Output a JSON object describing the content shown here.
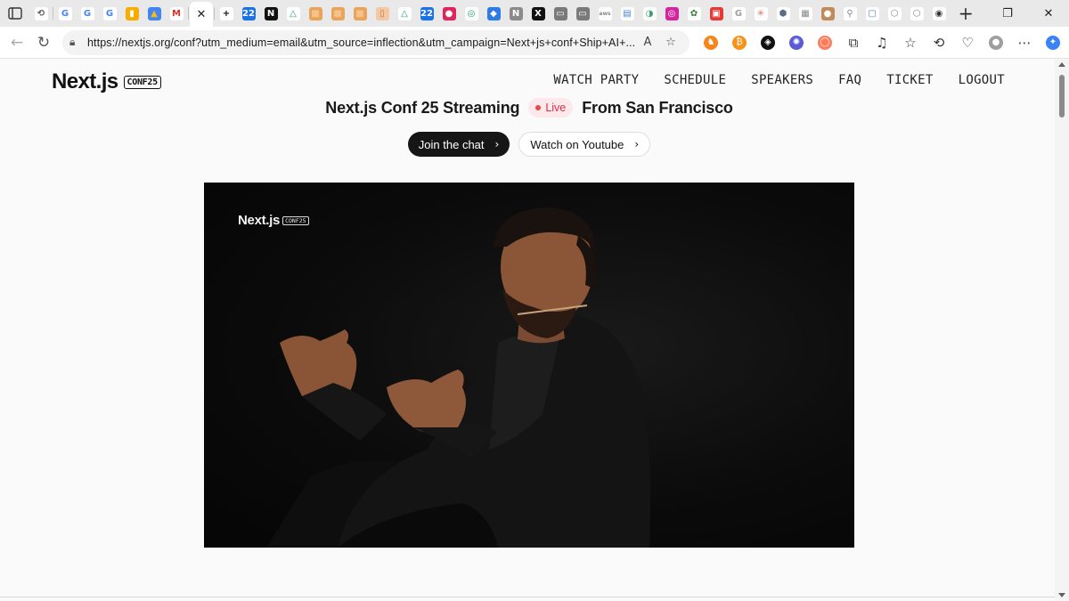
{
  "browser": {
    "tabs": [
      {
        "icon": "history-icon",
        "color": "#ffffff",
        "glyph": "⟲",
        "fg": "#555"
      },
      {
        "icon": "google-icon",
        "color": "#ffffff",
        "glyph": "G",
        "fg": "#4285f4"
      },
      {
        "icon": "google-icon",
        "color": "#ffffff",
        "glyph": "G",
        "fg": "#4285f4"
      },
      {
        "icon": "google-icon",
        "color": "#ffffff",
        "glyph": "G",
        "fg": "#4285f4"
      },
      {
        "icon": "analytics-icon",
        "color": "#f9ab00",
        "glyph": "▮",
        "fg": "#fff"
      },
      {
        "icon": "ads-icon",
        "color": "#4285f4",
        "glyph": "▲",
        "fg": "#fbbc04"
      },
      {
        "icon": "gmail-icon",
        "color": "#ffffff",
        "glyph": "M",
        "fg": "#d93025"
      },
      {
        "icon": "close-icon",
        "color": "#ffffff",
        "glyph": "✕",
        "fg": "#222",
        "active": true
      },
      {
        "icon": "notion-icon",
        "color": "#ffffff",
        "glyph": "+",
        "fg": "#111"
      },
      {
        "icon": "calendar-icon",
        "color": "#1a73e8",
        "glyph": "22",
        "fg": "#fff"
      },
      {
        "icon": "nextjs-icon",
        "color": "#111111",
        "glyph": "N",
        "fg": "#fff"
      },
      {
        "icon": "drive-icon",
        "color": "#ffffff",
        "glyph": "△",
        "fg": "#1fa463"
      },
      {
        "icon": "box-icon",
        "color": "#e8a45a",
        "glyph": "■",
        "fg": "#f6c28b"
      },
      {
        "icon": "box-icon",
        "color": "#e8a45a",
        "glyph": "■",
        "fg": "#f6c28b"
      },
      {
        "icon": "box-icon",
        "color": "#e8a45a",
        "glyph": "■",
        "fg": "#f6c28b"
      },
      {
        "icon": "bottle-icon",
        "color": "#f3c9a5",
        "glyph": "▯",
        "fg": "#c47a3a"
      },
      {
        "icon": "drive-icon",
        "color": "#ffffff",
        "glyph": "△",
        "fg": "#1fa463"
      },
      {
        "icon": "calendar-icon",
        "color": "#1a73e8",
        "glyph": "22",
        "fg": "#fff"
      },
      {
        "icon": "chat-icon",
        "color": "#e0245e",
        "glyph": "●",
        "fg": "#fff"
      },
      {
        "icon": "circle-icon",
        "color": "#ffffff",
        "glyph": "◎",
        "fg": "#20a35a"
      },
      {
        "icon": "cube-icon",
        "color": "#2d7be5",
        "glyph": "◆",
        "fg": "#fff"
      },
      {
        "icon": "n-icon",
        "color": "#8a8a8a",
        "glyph": "N",
        "fg": "#fff"
      },
      {
        "icon": "x-icon",
        "color": "#111111",
        "glyph": "X",
        "fg": "#fff"
      },
      {
        "icon": "window-icon",
        "color": "#7a7a7a",
        "glyph": "▭",
        "fg": "#fff"
      },
      {
        "icon": "window-icon",
        "color": "#7a7a7a",
        "glyph": "▭",
        "fg": "#fff"
      },
      {
        "icon": "aws-icon",
        "color": "#ffffff",
        "glyph": "aws",
        "fg": "#888"
      },
      {
        "icon": "doc-icon",
        "color": "#ffffff",
        "glyph": "▤",
        "fg": "#4a7fd4"
      },
      {
        "icon": "circle-icon",
        "color": "#ffffff",
        "glyph": "◑",
        "fg": "#2fa36b"
      },
      {
        "icon": "instagram-icon",
        "color": "#d6249f",
        "glyph": "◎",
        "fg": "#fff"
      },
      {
        "icon": "people-icon",
        "color": "#ffffff",
        "glyph": "✿",
        "fg": "#2e7d32"
      },
      {
        "icon": "badge-icon",
        "color": "#e53935",
        "glyph": "▣",
        "fg": "#fff"
      },
      {
        "icon": "google-icon",
        "color": "#ffffff",
        "glyph": "G",
        "fg": "#9aa0a6"
      },
      {
        "icon": "asterisk-icon",
        "color": "#ffffff",
        "glyph": "✳",
        "fg": "#d97757"
      },
      {
        "icon": "hex-icon",
        "color": "#ffffff",
        "glyph": "⬢",
        "fg": "#5b6b8a"
      },
      {
        "icon": "grid-icon",
        "color": "#ffffff",
        "glyph": "▦",
        "fg": "#888"
      },
      {
        "icon": "face-icon",
        "color": "#c08a5a",
        "glyph": "●",
        "fg": "#fff"
      },
      {
        "icon": "search-icon",
        "color": "#ffffff",
        "glyph": "⚲",
        "fg": "#7a8aa0"
      },
      {
        "icon": "screen-icon",
        "color": "#ffffff",
        "glyph": "▢",
        "fg": "#5b7fbf"
      },
      {
        "icon": "hex-icon",
        "color": "#ffffff",
        "glyph": "⬡",
        "fg": "#888"
      },
      {
        "icon": "hex-icon",
        "color": "#ffffff",
        "glyph": "⬡",
        "fg": "#888"
      },
      {
        "icon": "github-icon",
        "color": "#ffffff",
        "glyph": "◉",
        "fg": "#333"
      }
    ],
    "url": "https://nextjs.org/conf?utm_medium=email&utm_source=inflection&utm_campaign=Next+js+conf+Ship+AI+...",
    "extensions": [
      {
        "icon": "metamask-icon",
        "color": "#f6851b",
        "glyph": "♞"
      },
      {
        "icon": "coin-icon",
        "color": "#f7931a",
        "glyph": "₿"
      },
      {
        "icon": "wallet-icon",
        "color": "#111111",
        "glyph": "◈"
      },
      {
        "icon": "gear-icon",
        "color": "#5b5bd6",
        "glyph": "✺"
      },
      {
        "icon": "ring-icon",
        "color": "#ff7b5a",
        "glyph": "◯"
      },
      {
        "icon": "puzzle-icon",
        "color": "",
        "glyph": "⧉"
      },
      {
        "icon": "music-icon",
        "color": "",
        "glyph": "♫"
      },
      {
        "icon": "favorites-icon",
        "color": "",
        "glyph": "☆"
      },
      {
        "icon": "history-icon",
        "color": "",
        "glyph": "⟲"
      },
      {
        "icon": "health-icon",
        "color": "",
        "glyph": "♡"
      },
      {
        "icon": "profile-icon",
        "color": "#9e9e9e",
        "glyph": "●"
      },
      {
        "icon": "more-icon",
        "color": "",
        "glyph": "⋯"
      },
      {
        "icon": "copilot-icon",
        "color": "#3b82f6",
        "glyph": "✦"
      }
    ]
  },
  "site": {
    "logo_text": "Next.js",
    "logo_badge": "CONF25",
    "nav": [
      "WATCH PARTY",
      "SCHEDULE",
      "SPEAKERS",
      "FAQ",
      "TICKET",
      "LOGOUT"
    ],
    "headline_left": "Next.js Conf 25 Streaming",
    "live_label": "Live",
    "headline_right": "From San Francisco",
    "buttons": {
      "join_chat": "Join the chat",
      "watch_youtube": "Watch on Youtube"
    },
    "video": {
      "logo_text": "Next.js",
      "logo_badge": "CONF25"
    }
  }
}
